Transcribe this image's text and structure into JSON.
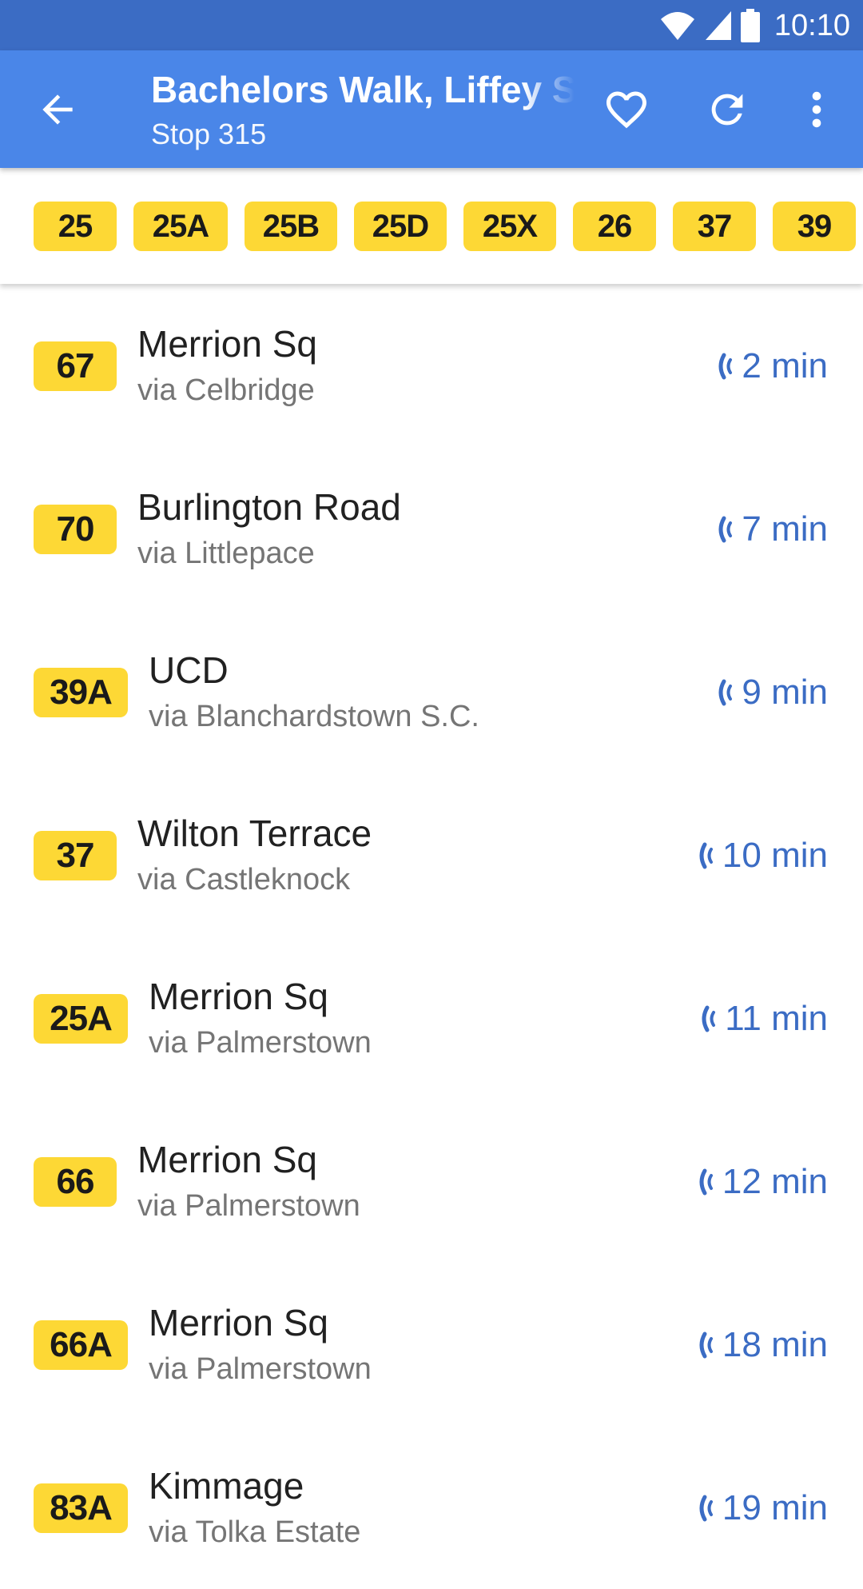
{
  "status_bar": {
    "time": "10:10",
    "icons": [
      "wifi-icon",
      "cell-signal-icon",
      "battery-icon"
    ]
  },
  "app_bar": {
    "title": "Bachelors Walk, Liffey St",
    "subtitle": "Stop 315",
    "icons": [
      "back-arrow-icon",
      "heart-icon",
      "refresh-icon",
      "more-vert-icon"
    ]
  },
  "route_chips": [
    "25",
    "25A",
    "25B",
    "25D",
    "25X",
    "26",
    "37",
    "39"
  ],
  "departures": [
    {
      "route": "67",
      "destination": "Merrion Sq",
      "via": "via Celbridge",
      "eta": "2 min"
    },
    {
      "route": "70",
      "destination": "Burlington Road",
      "via": "via Littlepace",
      "eta": "7 min"
    },
    {
      "route": "39A",
      "destination": "UCD",
      "via": "via Blanchardstown S.C.",
      "eta": "9 min"
    },
    {
      "route": "37",
      "destination": "Wilton Terrace",
      "via": "via Castleknock",
      "eta": "10 min"
    },
    {
      "route": "25A",
      "destination": "Merrion Sq",
      "via": "via Palmerstown",
      "eta": "11 min"
    },
    {
      "route": "66",
      "destination": "Merrion Sq",
      "via": "via Palmerstown",
      "eta": "12 min"
    },
    {
      "route": "66A",
      "destination": "Merrion Sq",
      "via": "via Palmerstown",
      "eta": "18 min"
    },
    {
      "route": "83A",
      "destination": "Kimmage",
      "via": "via Tolka Estate",
      "eta": "19 min"
    }
  ],
  "colors": {
    "status_bar": "#3b6cc4",
    "app_bar": "#4a86e8",
    "route_badge": "#fdd835",
    "eta_text": "#3b6cc4"
  }
}
